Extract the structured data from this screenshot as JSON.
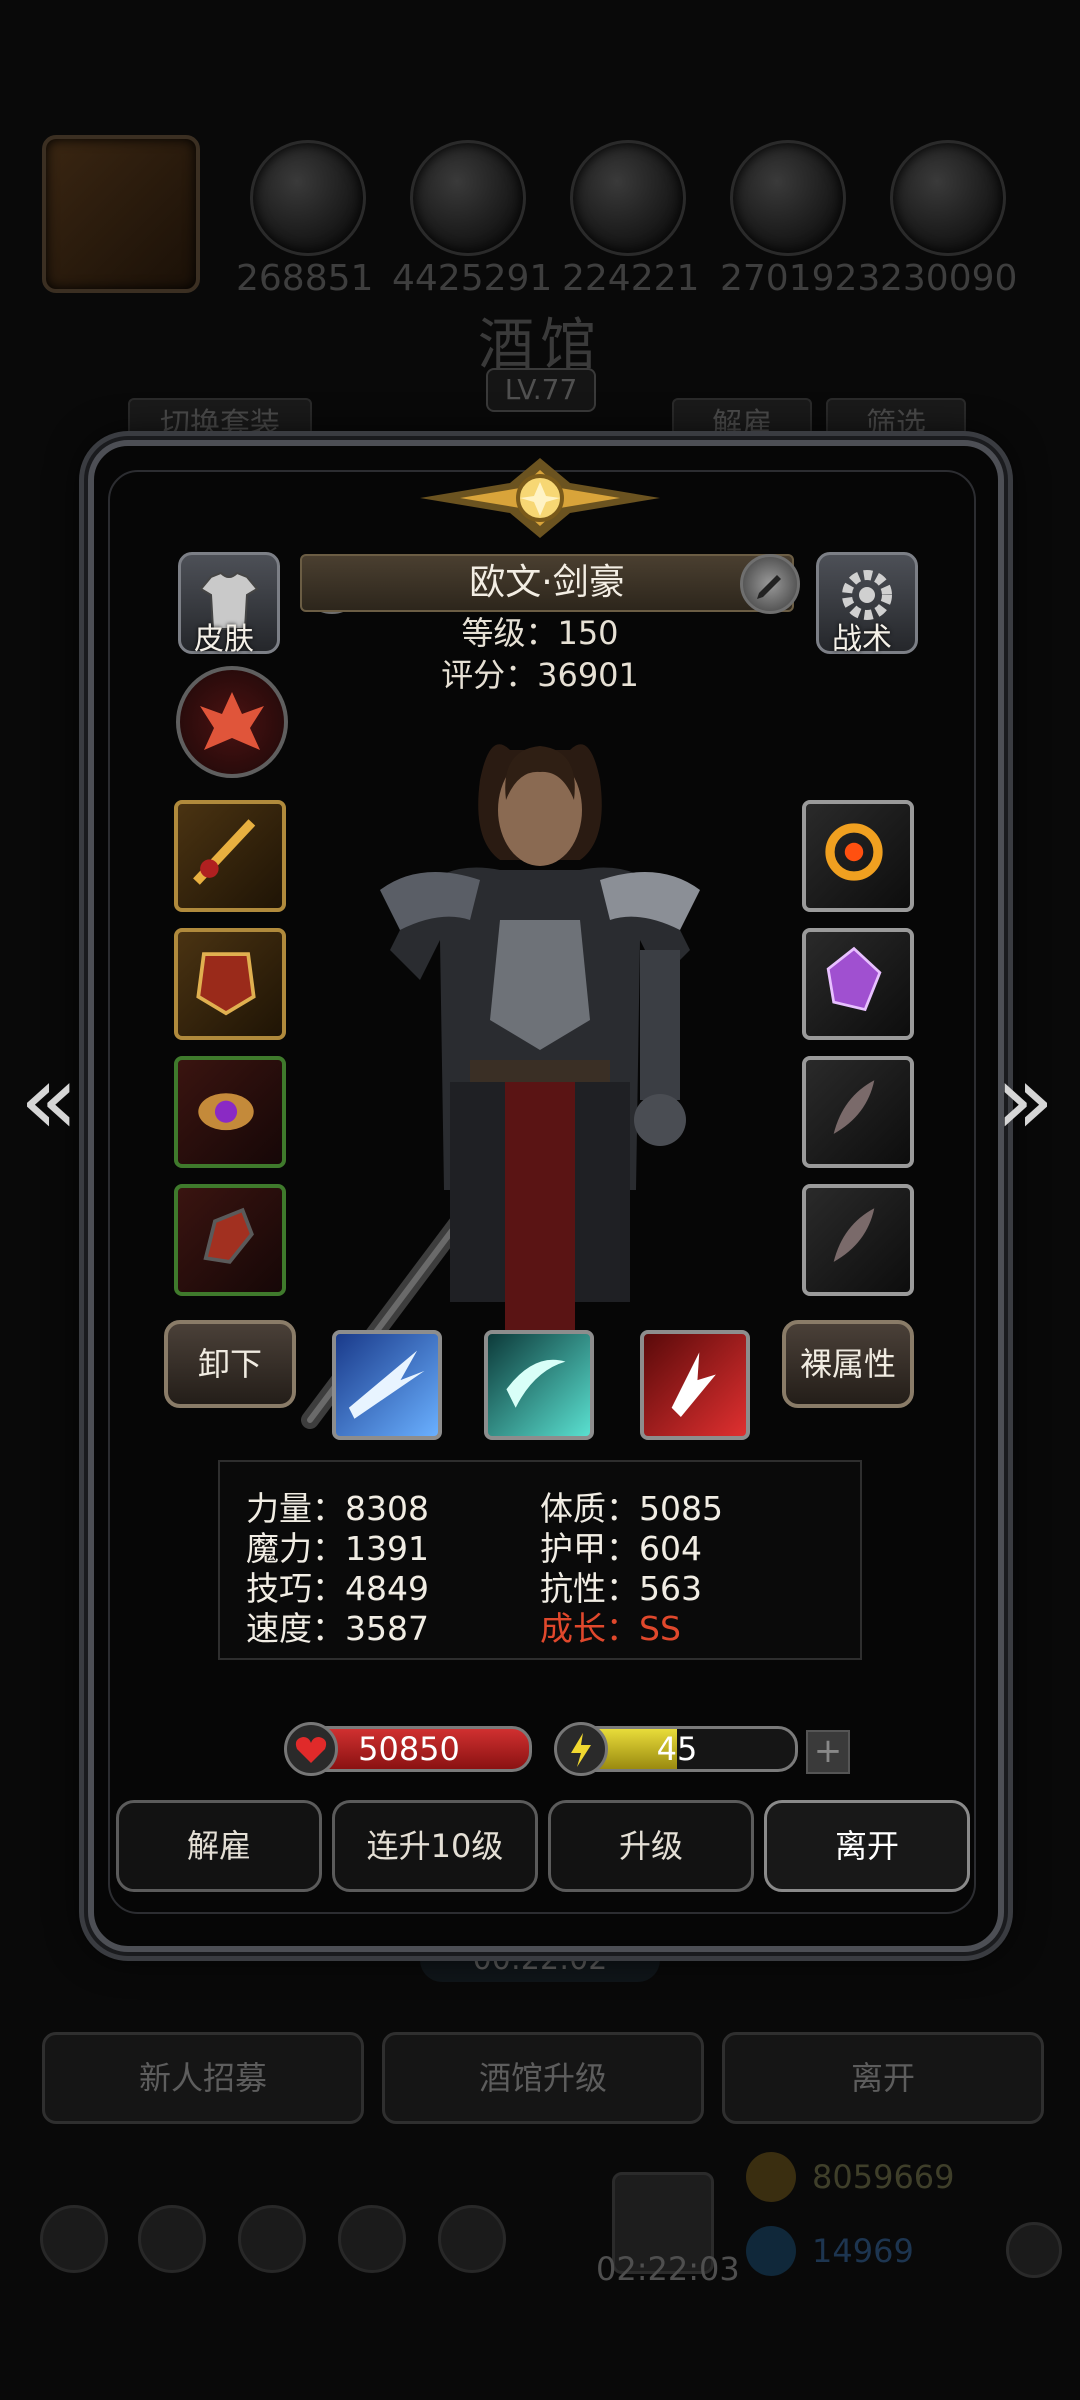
{
  "background": {
    "resource_values": [
      "268851",
      "4425291",
      "224221",
      "2701923",
      "230090"
    ],
    "tavern_title": "酒馆",
    "tavern_level": "LV.77",
    "tab_switch_outfit": "切换套装",
    "tab_dismiss": "解雇",
    "tab_filter": "筛选",
    "timer": "00:22:02",
    "bottom_buttons": [
      "新人招募",
      "酒馆升级",
      "离开"
    ],
    "gift_timer": "02:22:03",
    "gold": "8059669",
    "gems": "14969"
  },
  "hero": {
    "name": "欧文·剑豪",
    "level_text": "等级：150",
    "score_text": "评分：36901",
    "skin_label": "皮肤",
    "tactics_label": "战术",
    "unequip_label": "卸下",
    "base_attr_label": "裸属性"
  },
  "stats": [
    {
      "label": "力量：8308"
    },
    {
      "label": "魔力：1391"
    },
    {
      "label": "技巧：4849"
    },
    {
      "label": "速度：3587"
    },
    {
      "label": "体质：5085"
    },
    {
      "label": "护甲：604"
    },
    {
      "label": "抗性：563"
    },
    {
      "label": "成长：SS"
    }
  ],
  "bars": {
    "hp": "50850",
    "energy": "45",
    "energy_fill_fraction": 0.5
  },
  "actions": [
    "解雇",
    "连升10级",
    "升级",
    "离开"
  ],
  "colors": {
    "growth": "#e0482c",
    "hp": "#d03030",
    "energy": "#e8dc3a"
  }
}
